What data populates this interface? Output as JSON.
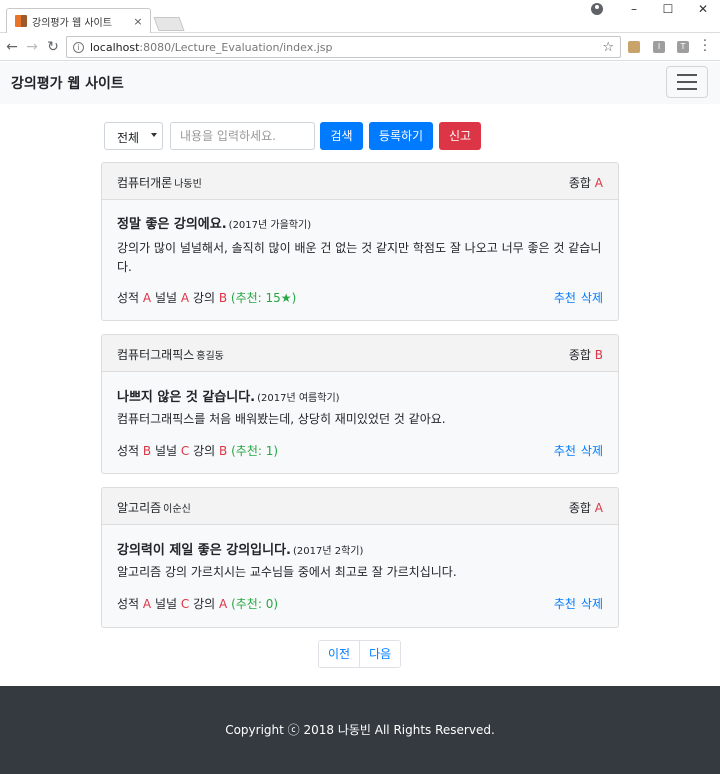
{
  "browser": {
    "tab_title": "강의평가 웹 사이트",
    "tab_close": "×",
    "url_host": "localhost",
    "url_path": ":8080/Lecture_Evaluation/index.jsp",
    "min_glyph": "–",
    "max_glyph": "☐",
    "close_glyph": "✕"
  },
  "navbar": {
    "brand": "강의평가 웹 사이트"
  },
  "search": {
    "category_selected": "전체",
    "placeholder": "내용을 입력하세요.",
    "search_label": "검색",
    "register_label": "등록하기",
    "report_label": "신고"
  },
  "evaluations": [
    {
      "lecture": "컴퓨터개론",
      "professor": "나동빈",
      "total_label": "종합",
      "total_grade": "A",
      "title": "정말 좋은 강의에요.",
      "semester": "(2017년 가을학기)",
      "content": "강의가 많이 널널해서, 솔직히 많이 배운 건 없는 것 같지만 학점도 잘 나오고 너무 좋은 것 같습니다.",
      "credit_label": "성적",
      "credit_grade": "A",
      "free_label": "널널",
      "free_grade": "A",
      "lecture_label": "강의",
      "lecture_grade": "B",
      "likes": "(추천: 15★)",
      "like_action": "추천",
      "delete_action": "삭제"
    },
    {
      "lecture": "컴퓨터그래픽스",
      "professor": "홍길동",
      "total_label": "종합",
      "total_grade": "B",
      "title": "나쁘지 않은 것 같습니다.",
      "semester": "(2017년 여름학기)",
      "content": "컴퓨터그래픽스를 처음 배워봤는데, 상당히 재미있었던 것 같아요.",
      "credit_label": "성적",
      "credit_grade": "B",
      "free_label": "널널",
      "free_grade": "C",
      "lecture_label": "강의",
      "lecture_grade": "B",
      "likes": "(추천: 1)",
      "like_action": "추천",
      "delete_action": "삭제"
    },
    {
      "lecture": "알고리즘",
      "professor": "이순신",
      "total_label": "종합",
      "total_grade": "A",
      "title": "강의력이 제일 좋은 강의입니다.",
      "semester": "(2017년 2학기)",
      "content": "알고리즘 강의 가르치시는 교수님들 중에서 최고로 잘 가르치십니다.",
      "credit_label": "성적",
      "credit_grade": "A",
      "free_label": "널널",
      "free_grade": "C",
      "lecture_label": "강의",
      "lecture_grade": "A",
      "likes": "(추천: 0)",
      "like_action": "추천",
      "delete_action": "삭제"
    }
  ],
  "pagination": {
    "prev": "이전",
    "next": "다음"
  },
  "footer": {
    "copyright": "Copyright ⓒ 2018 나동빈 All Rights Reserved."
  },
  "colors": {
    "primary": "#007bff",
    "danger": "#dc3545",
    "success": "#28a745",
    "footer_bg": "#343a40",
    "navbar_bg": "#f8f9fa"
  }
}
